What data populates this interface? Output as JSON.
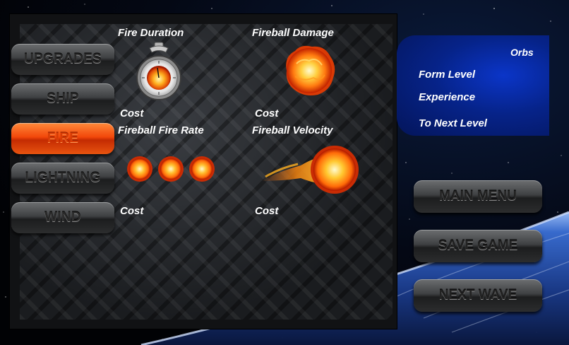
{
  "nav": {
    "upgrades": "UPGRADES",
    "ship": "SHIP",
    "fire": "FIRE",
    "lightning": "LIGHTNING",
    "wind": "WIND",
    "active": "fire"
  },
  "upgrades": {
    "fire_duration": {
      "title": "Fire Duration",
      "cost_label": "Cost",
      "icon": "stopwatch-icon"
    },
    "fireball_damage": {
      "title": "Fireball Damage",
      "cost_label": "Cost",
      "icon": "fireball-icon"
    },
    "fireball_fire_rate": {
      "title": "Fireball Fire Rate",
      "cost_label": "Cost",
      "icon": "triple-fireball-icon"
    },
    "fireball_velocity": {
      "title": "Fireball Velocity",
      "cost_label": "Cost",
      "icon": "comet-fireball-icon"
    }
  },
  "stats": {
    "orbs": "Orbs",
    "form_level": "Form Level",
    "experience": "Experience",
    "to_next_level": "To Next Level"
  },
  "menu": {
    "main_menu": "MAIN MENU",
    "save_game": "SAVE GAME",
    "next_wave": "NEXT WAVE"
  },
  "colors": {
    "active_button": "#f2470a",
    "info_panel": "#062389"
  }
}
